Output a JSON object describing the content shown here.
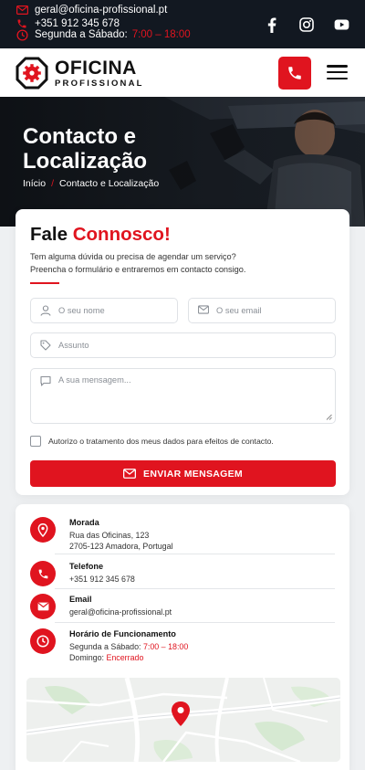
{
  "topbar": {
    "email": "geral@oficina-profissional.pt",
    "phone": "+351 912 345 678",
    "hours_label": "Segunda a Sábado:",
    "hours_value": "7:00 – 18:00",
    "social": [
      "facebook-icon",
      "instagram-icon",
      "youtube-icon"
    ]
  },
  "header": {
    "logo_line1": "OFICINA",
    "logo_line2": "PROFISSIONAL"
  },
  "hero": {
    "title": "Contacto e Localização",
    "breadcrumbs": [
      "Início",
      "Contacto e Localização"
    ],
    "breadcrumb_separator": "/"
  },
  "form": {
    "title_main": "Fale",
    "title_accent": "Connosco!",
    "description_line1": "Tem alguma dúvida ou precisa de agendar um serviço?",
    "description_line2": "Preencha o formulário e entraremos em contacto consigo.",
    "name_placeholder": "O seu nome",
    "email_placeholder": "O seu email",
    "subject_placeholder": "Assunto",
    "message_placeholder": "A sua mensagem...",
    "consent_label": "Autorizo o tratamento dos meus dados para efeitos de contacto.",
    "submit_label": "ENVIAR MENSAGEM"
  },
  "info": {
    "address": {
      "title": "Morada",
      "line1": "Rua das Oficinas, 123",
      "line2": "2705-123 Amadora, Portugal"
    },
    "phone": {
      "title": "Telefone",
      "value": "+351 912 345 678"
    },
    "email": {
      "title": "Email",
      "value": "geral@oficina-profissional.pt"
    },
    "hours": {
      "title": "Horário de Funcionamento",
      "weekday_label": "Segunda a Sábado:",
      "weekday_value": "7:00 – 18:00",
      "sunday_label": "Domingo:",
      "sunday_value": "Encerrado"
    }
  },
  "colors": {
    "accent": "#e0141f",
    "dark": "#121821"
  }
}
